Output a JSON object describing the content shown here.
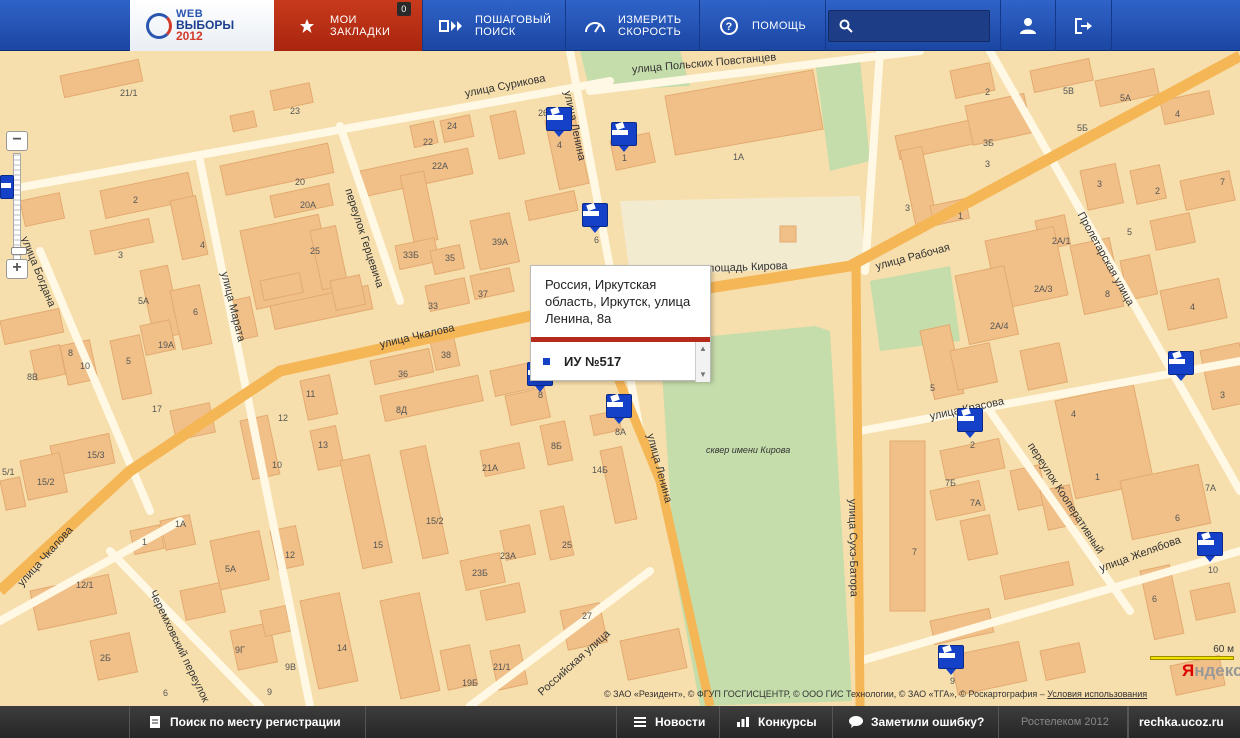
{
  "header": {
    "logo": {
      "line1": "WEB",
      "line2": "ВЫБОРЫ",
      "line3": "2012"
    },
    "nav": {
      "bookmarks": {
        "line1": "МОИ",
        "line2": "ЗАКЛАДКИ",
        "badge": "0",
        "icon": "star-icon"
      },
      "step_search": {
        "line1": "ПОШАГОВЫЙ",
        "line2": "ПОИСК",
        "icon": "steps-icon"
      },
      "speed": {
        "line1": "ИЗМЕРИТЬ",
        "line2": "СКОРОСТЬ",
        "icon": "speedometer-icon"
      },
      "help": {
        "label": "ПОМОЩЬ",
        "icon": "help-icon"
      }
    },
    "search": {
      "value": "",
      "placeholder": "",
      "icon": "search-icon"
    },
    "user_icon": "user-icon",
    "logout_icon": "logout-icon"
  },
  "map": {
    "streets": [
      "улица Сурикова",
      "улица Польских Повстанцев",
      "улица Ленина",
      "переулок Герцевича",
      "улица Марата",
      "улица Богдана",
      "площадь Кирова",
      "улица Рабочая",
      "Пролетарская улица",
      "улица Чкалова",
      "улица Ленина",
      "сквер имени Кирова",
      "улица Красова",
      "переулок Кооперативный",
      "улица Сухэ-Батора",
      "улица Желябова",
      "Черемховский переулок",
      "Российская улица",
      "улица Чкалова"
    ],
    "house_numbers": [
      "21/1",
      "23",
      "24",
      "26",
      "4",
      "1",
      "1А",
      "5В",
      "5А",
      "5Б",
      "4",
      "2",
      "3Б",
      "3",
      "7",
      "3",
      "2",
      "3",
      "5",
      "1",
      "20",
      "20А",
      "22",
      "22А",
      "39А",
      "35",
      "33Б",
      "25",
      "2",
      "3",
      "4",
      "5А",
      "6",
      "6",
      "37",
      "33",
      "19А",
      "8",
      "5",
      "8В",
      "10",
      "17",
      "36",
      "38",
      "11",
      "12",
      "8Д",
      "8",
      "8Б",
      "14Б",
      "13",
      "10",
      "15/3",
      "15/2",
      "5/1",
      "21А",
      "15/2",
      "15",
      "23А",
      "23Б",
      "25",
      "27",
      "1А",
      "5А",
      "12",
      "12/1",
      "1",
      "9Г",
      "9В",
      "9",
      "14",
      "19Б",
      "21/1",
      "2Б",
      "6",
      "2А/1",
      "2А/3",
      "8",
      "2А/4",
      "4",
      "3",
      "5",
      "2",
      "7Б",
      "7А",
      "4",
      "1",
      "6",
      "7А",
      "7",
      "6",
      "10",
      "9",
      "8А"
    ],
    "popup": {
      "address": "Россия, Иркутская область, Иркутск, улица Ленина, 8а",
      "item": "ИУ №517"
    },
    "scale": "60 м",
    "provider_logo": {
      "a": "Я",
      "b": "ндекс"
    },
    "copyright": "© ЗАО «Резидент», © ФГУП ГОСГИСЦЕНТР, © ООО ГИС Технологии, © ЗАО «ТГА», © Роскартография –",
    "terms": "Условия использования"
  },
  "footer": {
    "registration": {
      "label": "Поиск по месту регистрации",
      "icon": "document-icon"
    },
    "news": {
      "label": "Новости",
      "icon": "list-icon"
    },
    "contests": {
      "label": "Конкурсы",
      "icon": "bar-chart-icon"
    },
    "error": {
      "label": "Заметили ошибку?",
      "icon": "chat-bubble-icon"
    },
    "copyright": "Ростелеком 2012",
    "site": "rechka.ucoz.ru"
  },
  "colors": {
    "header_blue": "#1b46a3",
    "bookmark_red": "#b82f16",
    "marker_blue": "#1441c8",
    "map_bg": "#f7dfad",
    "block": "#f0c088",
    "main_road": "#f5b655",
    "park": "#c5dcab"
  }
}
